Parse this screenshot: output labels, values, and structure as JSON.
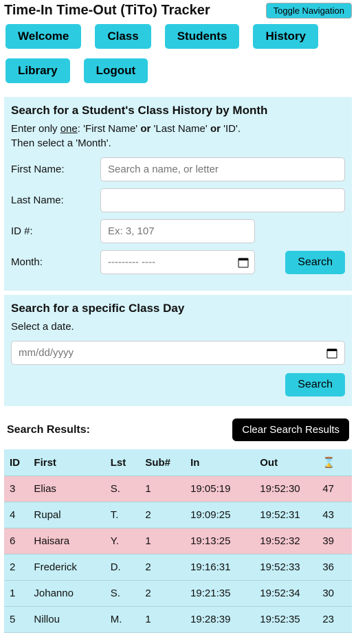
{
  "header": {
    "title": "Time-In Time-Out (TiTo) Tracker",
    "toggle": "Toggle Navigation"
  },
  "nav": {
    "items": [
      "Welcome",
      "Class",
      "Students",
      "History",
      "Library",
      "Logout"
    ]
  },
  "panel_month": {
    "title": "Search for a Student's Class History by Month",
    "inst_prefix": "Enter only ",
    "inst_one": "one",
    "inst_mid1": ": 'First Name' ",
    "inst_or": "or",
    "inst_mid2": " 'Last Name' ",
    "inst_mid3": " 'ID'.",
    "inst2": "Then select a 'Month'.",
    "labels": {
      "first": "First Name:",
      "last": "Last Name:",
      "id": "ID #:",
      "month": "Month:"
    },
    "placeholders": {
      "first": "Search a name, or letter",
      "id": "Ex: 3, 107",
      "month": "--------- ----"
    },
    "search": "Search"
  },
  "panel_day": {
    "title": "Search for a specific Class Day",
    "inst": "Select a date.",
    "placeholder": "mm/dd/yyyy",
    "search": "Search"
  },
  "results": {
    "heading": "Search Results:",
    "clear": "Clear Search Results",
    "columns": {
      "id": "ID",
      "first": "First",
      "last": "Lst",
      "sub": "Sub#",
      "in": "In",
      "out": "Out",
      "dur_icon": "⌛"
    },
    "rows": [
      {
        "id": "3",
        "first": "Elias",
        "last": "S.",
        "sub": "1",
        "in": "19:05:19",
        "out": "19:52:30",
        "dur": "47",
        "flag": true
      },
      {
        "id": "4",
        "first": "Rupal",
        "last": "T.",
        "sub": "2",
        "in": "19:09:25",
        "out": "19:52:31",
        "dur": "43",
        "flag": false
      },
      {
        "id": "6",
        "first": "Haisara",
        "last": "Y.",
        "sub": "1",
        "in": "19:13:25",
        "out": "19:52:32",
        "dur": "39",
        "flag": true
      },
      {
        "id": "2",
        "first": "Frederick",
        "last": "D.",
        "sub": "2",
        "in": "19:16:31",
        "out": "19:52:33",
        "dur": "36",
        "flag": false
      },
      {
        "id": "1",
        "first": "Johanno",
        "last": "S.",
        "sub": "2",
        "in": "19:21:35",
        "out": "19:52:34",
        "dur": "30",
        "flag": false
      },
      {
        "id": "5",
        "first": "Nillou",
        "last": "M.",
        "sub": "1",
        "in": "19:28:39",
        "out": "19:52:35",
        "dur": "23",
        "flag": false
      }
    ]
  }
}
